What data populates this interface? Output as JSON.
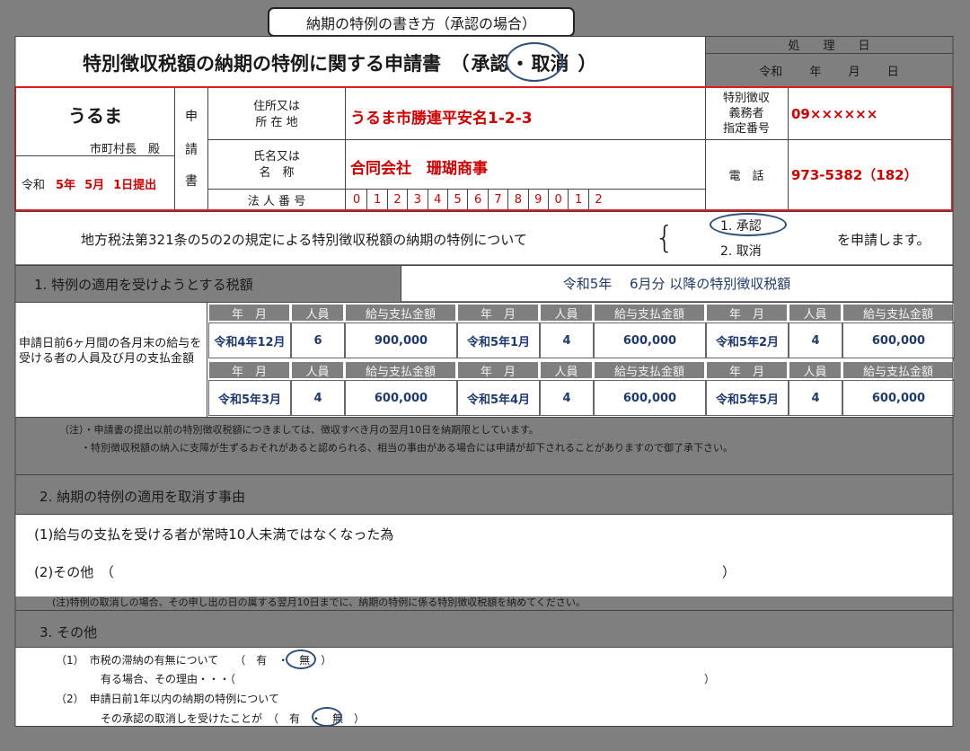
{
  "caption": "納期の特例の書き方（承認の場合）",
  "header": {
    "title": "特別徴収税額の納期の特例に関する申請書　（",
    "approve": "承認",
    "dot": "・",
    "cancel": "取消",
    "close": "）",
    "processing_date": "処　　理　　日",
    "era_date": "令和　　 年　　 月　　 日"
  },
  "applicant": {
    "city": "うるま",
    "mayor": "市町村長　殿",
    "submit_era": "令和",
    "submit_year": "5年",
    "submit_month": "5月",
    "submit_day": "1日提出",
    "vertical": [
      "申",
      "請",
      "書"
    ],
    "address_label_1": "住所又は",
    "address_label_2": "所 在 地",
    "address_value": "うるま市勝連平安名1-2-3",
    "name_label_1": "氏名又は",
    "name_label_2": "名　称",
    "name_value": "合同会社　珊瑚商事",
    "corp_label": "法 人 番 号",
    "corp_digits": [
      "0",
      "1",
      "2",
      "3",
      "4",
      "5",
      "6",
      "7",
      "8",
      "9",
      "0",
      "1",
      "2"
    ],
    "obligor_label_1": "特別徴収",
    "obligor_label_2": "義務者",
    "obligor_label_3": "指定番号",
    "obligor_value": "09××××××",
    "phone_label": "電　話",
    "phone_value": "973-5382（182）"
  },
  "statement": {
    "law_text": "地方税法第321条の5の2の規定による特別徴収税額の納期の特例について",
    "option1": "1. 承認",
    "option2": "2. 取消",
    "suffix": "を申請します。"
  },
  "section1": {
    "title": "1. 特例の適用を受けようとする税額",
    "applied": "令和5年　 6月分  以降の特別徴収税額",
    "side_label": "申請日前6ヶ月間の各月末の給与を受ける者の人員及び月の支払金額",
    "col_month": "年　月",
    "col_staff": "人員",
    "col_amount": "給与支払金額",
    "rows": [
      [
        {
          "month": "令和4年12月",
          "staff": "6",
          "amount": "900,000"
        },
        {
          "month": "令和5年1月",
          "staff": "4",
          "amount": "600,000"
        },
        {
          "month": "令和5年2月",
          "staff": "4",
          "amount": "600,000"
        }
      ],
      [
        {
          "month": "令和5年3月",
          "staff": "4",
          "amount": "600,000"
        },
        {
          "month": "令和5年4月",
          "staff": "4",
          "amount": "600,000"
        },
        {
          "month": "令和5年5月",
          "staff": "4",
          "amount": "600,000"
        }
      ]
    ],
    "note1": "（注）・申請書の提出以前の特別徴収税額につきましては、徴収すべき月の翌月10日を納期限としています。",
    "note2": "・特別徴収税額の納入に支障が生ずるおそれがあると認められる、相当の事由がある場合には申請が却下されることがありますので御了承下さい。"
  },
  "section2": {
    "title": "2. 納期の特例の適用を取消す事由",
    "item1": "(1)給与の支払を受ける者が常時10人未満ではなくなった為",
    "item2_open": "(2)その他　（",
    "item2_close": "）",
    "note": "(注)特例の取消しの場合、その申し出の日の属する翌月10日までに、納期の特例に係る特別徴収税額を納めてください。"
  },
  "section3": {
    "title": "3. その他",
    "q1": "（1）　市税の滞納の有無について　　（　有　・　無　）",
    "q1_reason_open": "有る場合、その理由・・・（",
    "q1_reason_close": "）",
    "q2": "（2）　申請日前1年以内の納期の特例について",
    "q2_sub": "その承認の取消しを受けたことが　（　有　・　無　）"
  }
}
